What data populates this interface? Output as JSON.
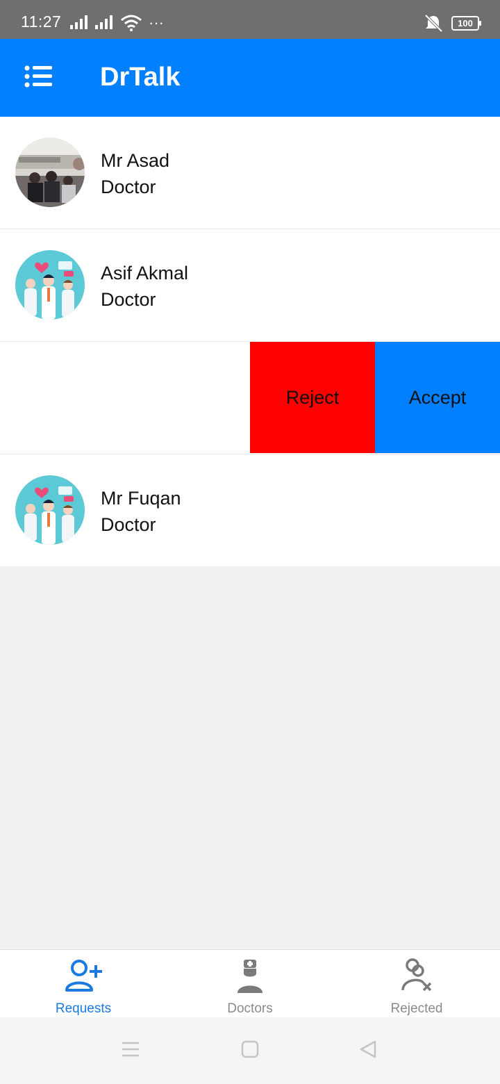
{
  "status_bar": {
    "time": "11:27",
    "more": "···",
    "battery": "100"
  },
  "app_bar": {
    "title": "DrTalk",
    "menu_icon": "menu-list-icon"
  },
  "requests": [
    {
      "name": "Mr Asad",
      "role": "Doctor",
      "avatar": "photo-group-avatar"
    },
    {
      "name": "Asif Akmal",
      "role": "Doctor",
      "avatar": "doctors-illustration-avatar"
    },
    {
      "name": "",
      "role": "",
      "avatar": ""
    },
    {
      "name": "Mr Fuqan",
      "role": "Doctor",
      "avatar": "doctors-illustration-avatar"
    }
  ],
  "swipe_actions": {
    "reject": "Reject",
    "accept": "Accept"
  },
  "bottom_nav": {
    "items": [
      {
        "label": "Requests",
        "icon": "add-user-icon",
        "active": true
      },
      {
        "label": "Doctors",
        "icon": "doctor-icon",
        "active": false
      },
      {
        "label": "Rejected",
        "icon": "reject-user-icon",
        "active": false
      }
    ]
  },
  "colors": {
    "primary": "#0080ff",
    "reject": "#ff0000",
    "active_tab": "#1a7ae0"
  }
}
